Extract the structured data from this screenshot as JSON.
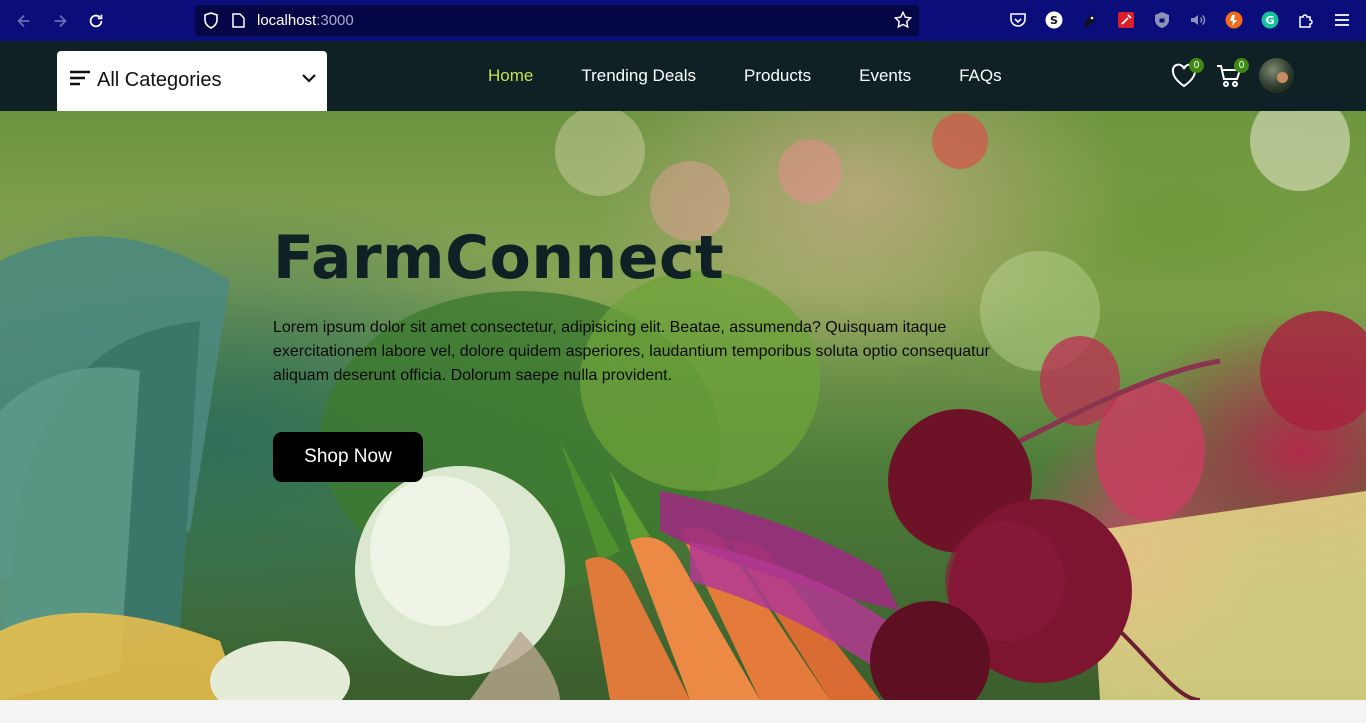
{
  "browser": {
    "url_host": "localhost",
    "url_port": ":3000"
  },
  "header": {
    "categories_label": "All Categories",
    "nav": [
      {
        "label": "Home",
        "active": true
      },
      {
        "label": "Trending Deals",
        "active": false
      },
      {
        "label": "Products",
        "active": false
      },
      {
        "label": "Events",
        "active": false
      },
      {
        "label": "FAQs",
        "active": false
      }
    ],
    "wishlist_count": "0",
    "cart_count": "0"
  },
  "hero": {
    "title": "FarmConnect",
    "description_line1": "Lorem ipsum dolor sit amet consectetur, adipisicing elit. Beatae, assumenda? Quisquam itaque exercitationem labore vel, dolore quidem asperiores, laudantium temporibus soluta optio consequatur",
    "description_line2": "aliquam deserunt officia. Dolorum saepe nulla provident.",
    "cta_label": "Shop Now"
  },
  "colors": {
    "header_bg": "#0f2124",
    "browser_bg": "#0b0d7a",
    "active_nav": "#c8e04a",
    "badge": "#3f8a14",
    "cta_bg": "#000000"
  },
  "icons": [
    "back-icon",
    "forward-icon",
    "reload-icon",
    "shield-icon",
    "page-icon",
    "star-icon",
    "pocket-icon",
    "extension-icon",
    "wishlist-heart-icon",
    "cart-icon",
    "menu-icon",
    "chevron-down-icon",
    "hamburger-icon"
  ]
}
